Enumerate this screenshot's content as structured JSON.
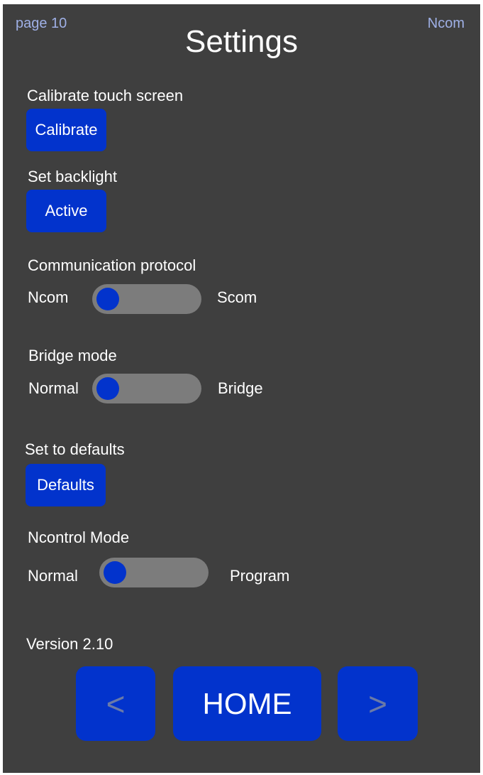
{
  "header": {
    "page_label": "page 10",
    "protocol_indicator": "Ncom",
    "title": "Settings"
  },
  "calibrate": {
    "label": "Calibrate touch screen",
    "button": "Calibrate"
  },
  "backlight": {
    "label": "Set backlight",
    "button": "Active"
  },
  "communication": {
    "label": "Communication protocol",
    "left": "Ncom",
    "right": "Scom",
    "state": "Ncom"
  },
  "bridge": {
    "label": "Bridge mode",
    "left": "Normal",
    "right": "Bridge",
    "state": "Normal"
  },
  "defaults": {
    "label": "Set to defaults",
    "button": "Defaults"
  },
  "ncontrol": {
    "label": "Ncontrol Mode",
    "left": "Normal",
    "right": "Program",
    "state": "Normal"
  },
  "version": "Version 2.10",
  "nav": {
    "prev": "<",
    "home": "HOME",
    "next": ">"
  },
  "colors": {
    "background": "#3f3f3f",
    "button": "#0233cc",
    "toggle_track": "#7c7c7c",
    "accent_text": "#9fb0e6"
  }
}
